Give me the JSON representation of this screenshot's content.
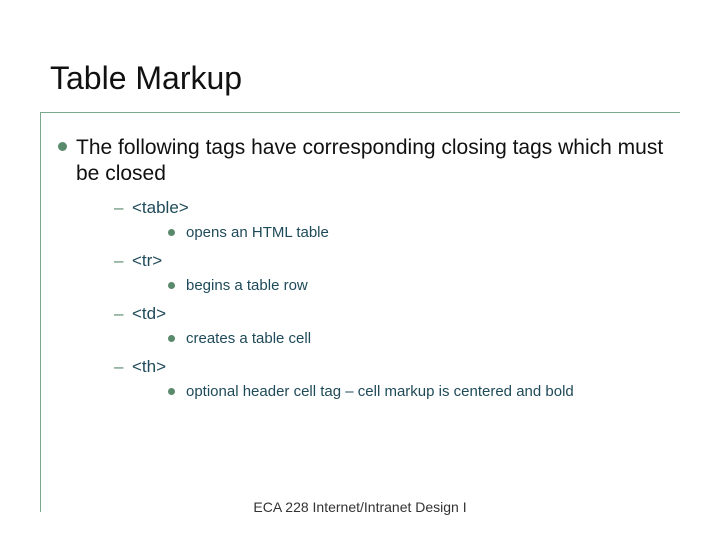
{
  "title": "Table Markup",
  "intro": "The following tags have corresponding closing tags which must be closed",
  "items": [
    {
      "tag": "<table>",
      "desc": "opens an HTML table"
    },
    {
      "tag": "<tr>",
      "desc": "begins a table row"
    },
    {
      "tag": "<td>",
      "desc": "creates a table cell"
    },
    {
      "tag": "<th>",
      "desc": "optional header cell tag – cell markup is centered and bold"
    }
  ],
  "footer": "ECA 228  Internet/Intranet Design I"
}
